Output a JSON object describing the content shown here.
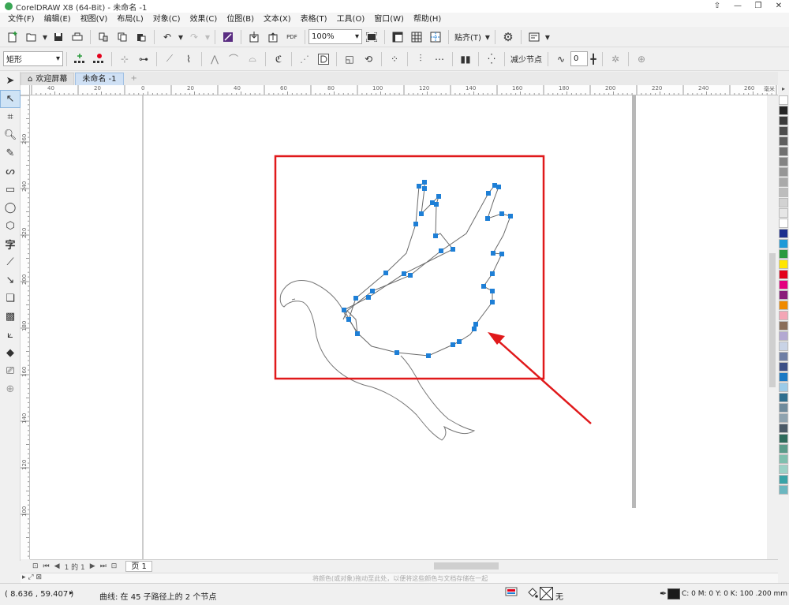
{
  "window": {
    "title": "CorelDRAW X8 (64-Bit) - 未命名 -1",
    "controls": [
      "⇧",
      "—",
      "❐",
      "✕"
    ]
  },
  "menu": [
    "文件(F)",
    "编辑(E)",
    "视图(V)",
    "布局(L)",
    "对象(C)",
    "效果(C)",
    "位图(B)",
    "文本(X)",
    "表格(T)",
    "工具(O)",
    "窗口(W)",
    "帮助(H)"
  ],
  "toolbar1": {
    "zoom": "100%",
    "snap_label": "贴齐(T)"
  },
  "toolbar2": {
    "shape_select": "矩形",
    "reduce_nodes_label": "减少节点",
    "smooth_value": "0"
  },
  "tabs": [
    {
      "label": "欢迎屏幕"
    },
    {
      "label": "未命名 -1"
    }
  ],
  "ruler_top": [
    "40",
    "20",
    "0",
    "20",
    "40",
    "60",
    "80",
    "100",
    "120",
    "140",
    "160",
    "180",
    "200",
    "220",
    "240",
    "260",
    "毫米"
  ],
  "ruler_left": [
    "260",
    "240",
    "220",
    "200",
    "180",
    "160",
    "140",
    "120",
    "100"
  ],
  "pagebar": {
    "page_info": "1 的 1",
    "page_tab": "页 1"
  },
  "hint": "将颜色(或对象)拖动至此处，以便将这些颜色与文档存储在一起",
  "status": {
    "coords": "( 8.636 , 59.407 )",
    "message": "曲线: 在 45 子路径上的 2 个节点",
    "fill": "无",
    "outline": "C: 0 M: 0 Y: 0 K: 100  .200 mm"
  },
  "colors": {
    "accent": "#1e7fd6",
    "highlight_box": "#e0191b",
    "palette": [
      "#ffffff",
      "#262626",
      "#3b3b3b",
      "#4d4d4d",
      "#5e5e5e",
      "#707070",
      "#838383",
      "#969696",
      "#aaaaaa",
      "#bdbdbd",
      "#d2d2d2",
      "#e6e6e6",
      "#ffffff",
      "#1d2f8f",
      "#1f9ad8",
      "#2a9a3d",
      "#ffe600",
      "#e3001b",
      "#e4007f",
      "#8a1d7a",
      "#f08a00",
      "#f4a6b6",
      "#8a6e5a",
      "#b3a8d2",
      "#c9d3e6",
      "#6e7ea5",
      "#3c4f86",
      "#1b79c4",
      "#9ccbe8",
      "#2f6f8f",
      "#6f8b9c",
      "#8fa3af",
      "#4c5a67",
      "#2f6b5c",
      "#5b9b8a",
      "#7fbfae",
      "#9bd1c6",
      "#39a3a7",
      "#6bb7c0"
    ]
  }
}
